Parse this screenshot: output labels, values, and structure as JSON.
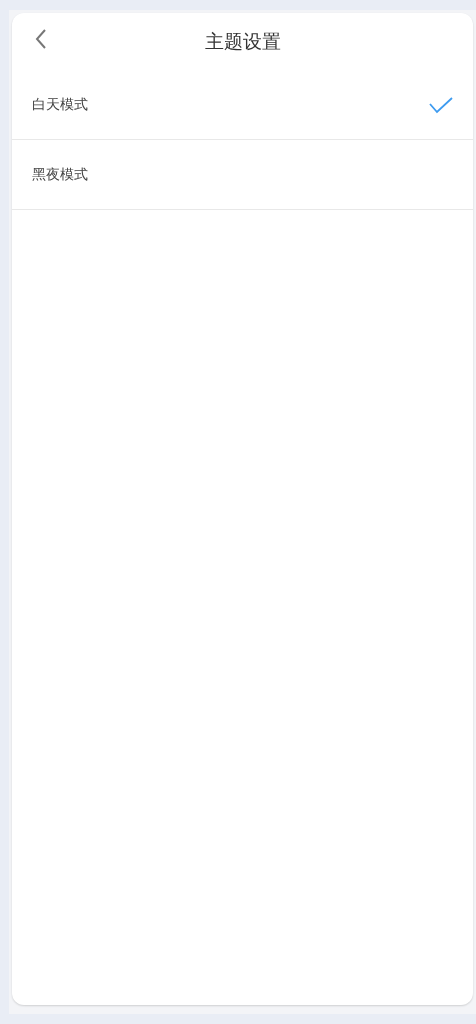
{
  "header": {
    "title": "主题设置"
  },
  "options": [
    {
      "label": "白天模式",
      "selected": true
    },
    {
      "label": "黑夜模式",
      "selected": false
    }
  ]
}
